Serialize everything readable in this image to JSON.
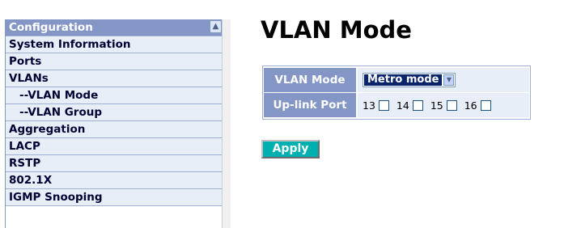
{
  "sidebar": {
    "items": [
      {
        "label": "Configuration"
      },
      {
        "label": "System Information"
      },
      {
        "label": "Ports"
      },
      {
        "label": "VLANs"
      },
      {
        "label": "--VLAN Mode"
      },
      {
        "label": "--VLAN Group"
      },
      {
        "label": "Aggregation"
      },
      {
        "label": "LACP"
      },
      {
        "label": "RSTP"
      },
      {
        "label": "802.1X"
      },
      {
        "label": "IGMP Snooping"
      }
    ]
  },
  "main": {
    "title": "VLAN Mode",
    "vlan_mode": {
      "label": "VLAN Mode",
      "selected": "Metro mode"
    },
    "uplink": {
      "label": "Up-link Port",
      "ports": [
        {
          "number": "13",
          "checked": false
        },
        {
          "number": "14",
          "checked": false
        },
        {
          "number": "15",
          "checked": false
        },
        {
          "number": "16",
          "checked": false
        }
      ]
    },
    "apply_label": "Apply"
  },
  "icons": {
    "scroll_up": "chevron-up-icon",
    "dropdown": "chevron-down-icon"
  },
  "colors": {
    "header_bg": "#8496c6",
    "item_bg": "#e8eef8",
    "apply_bg": "#00b0b0",
    "selection": "#0a246a"
  }
}
